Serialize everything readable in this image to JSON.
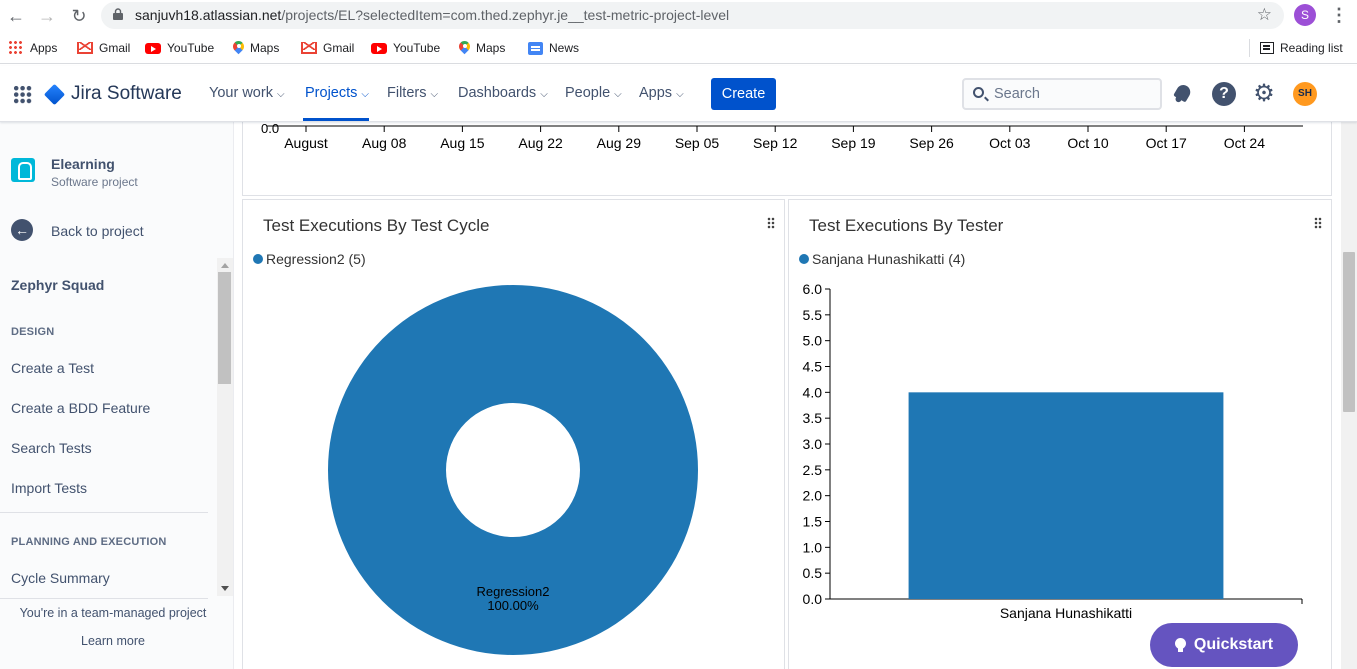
{
  "browser": {
    "url_domain": "sanjuvh18.atlassian.net",
    "url_path": "/projects/EL?selectedItem=com.thed.zephyr.je__test-metric-project-level",
    "profile_initial": "S",
    "bookmarks": [
      {
        "label": "Apps",
        "icon": "apps-grid-icon"
      },
      {
        "label": "Gmail",
        "icon": "gmail-icon"
      },
      {
        "label": "YouTube",
        "icon": "youtube-icon"
      },
      {
        "label": "Maps",
        "icon": "maps-icon"
      },
      {
        "label": "Gmail",
        "icon": "gmail-icon"
      },
      {
        "label": "YouTube",
        "icon": "youtube-icon"
      },
      {
        "label": "Maps",
        "icon": "maps-icon"
      },
      {
        "label": "News",
        "icon": "news-icon"
      }
    ],
    "reading_list": "Reading list"
  },
  "topnav": {
    "product": "Jira Software",
    "items": [
      {
        "label": "Your work"
      },
      {
        "label": "Projects"
      },
      {
        "label": "Filters"
      },
      {
        "label": "Dashboards"
      },
      {
        "label": "People"
      },
      {
        "label": "Apps"
      }
    ],
    "active_item": "Projects",
    "create_label": "Create",
    "search_placeholder": "Search",
    "avatar_initials": "SH",
    "avatar_color": "#ff991f"
  },
  "sidebar": {
    "project_name": "Elearning",
    "project_type": "Software project",
    "back_label": "Back to project",
    "section_title": "Zephyr Squad",
    "design_header": "DESIGN",
    "design_links": [
      "Create a Test",
      "Create a BDD Feature",
      "Search Tests",
      "Import Tests"
    ],
    "planning_header": "PLANNING AND EXECUTION",
    "planning_links": [
      "Cycle Summary"
    ],
    "team_note": "You're in a team-managed project",
    "learn_more": "Learn more"
  },
  "main": {
    "timeline_axis": {
      "partial_top_label": "0.0",
      "ticks": [
        "August",
        "Aug 08",
        "Aug 15",
        "Aug 22",
        "Aug 29",
        "Sep 05",
        "Sep 12",
        "Sep 19",
        "Sep 26",
        "Oct 03",
        "Oct 10",
        "Oct 17",
        "Oct 24"
      ]
    },
    "cycle_panel": {
      "title": "Test Executions By Test Cycle",
      "legend": "Regression2 (5)"
    },
    "tester_panel": {
      "title": "Test Executions By Tester",
      "legend": "Sanjana Hunashikatti (4)"
    },
    "quickstart_label": "Quickstart",
    "accent_color": "#0052cc",
    "series_color": "#1f77b4"
  },
  "chart_data": [
    {
      "type": "pie",
      "title": "Test Executions By Test Cycle",
      "donut": true,
      "slices": [
        {
          "label": "Regression2",
          "value": 5,
          "percent": "100.00%"
        }
      ],
      "legend_placement": "top-left"
    },
    {
      "type": "bar",
      "title": "Test Executions By Tester",
      "categories": [
        "Sanjana Hunashikatti"
      ],
      "values": [
        4
      ],
      "ylim": [
        0,
        6
      ],
      "yticks": [
        "0.0",
        "0.5",
        "1.0",
        "1.5",
        "2.0",
        "2.5",
        "3.0",
        "3.5",
        "4.0",
        "4.5",
        "5.0",
        "5.5",
        "6.0"
      ],
      "grid": false,
      "legend_placement": "top-left"
    }
  ]
}
